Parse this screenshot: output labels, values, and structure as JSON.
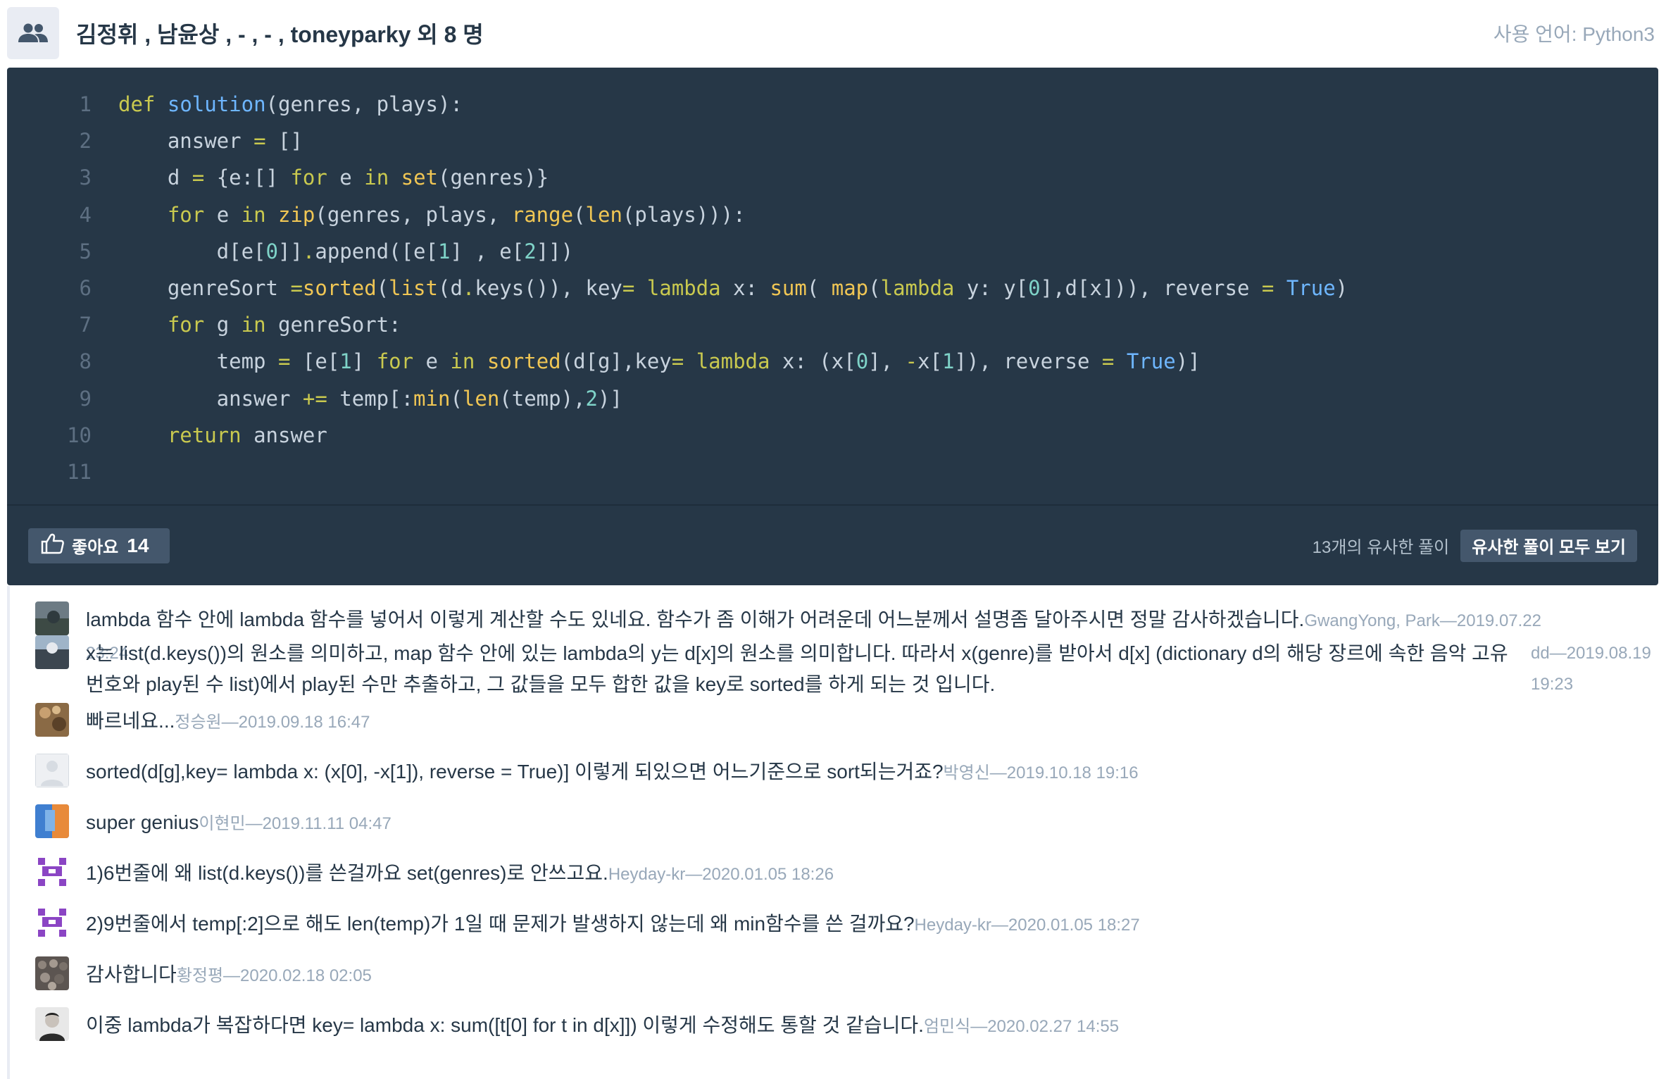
{
  "header": {
    "team_names": "김정휘 , 남윤상 , - , - , toneyparky 외 8 명",
    "language": "사용 언어: Python3"
  },
  "code": {
    "line_numbers": [
      "1",
      "2",
      "3",
      "4",
      "5",
      "6",
      "7",
      "8",
      "9",
      "10",
      "11"
    ]
  },
  "footer": {
    "like_label": "좋아요",
    "like_count": "14",
    "similar_count": "13개의 유사한 풀이",
    "similar_button": "유사한 풀이 모두 보기"
  },
  "comments": [
    {
      "text": "lambda 함수 안에 lambda 함수를 넣어서 이렇게 계산할 수도 있네요. 함수가 좀 이해가 어려운데 어느분께서 설명좀 달아주시면 정말 감사하겠습니다.",
      "meta": "GwangYong, Park—2019.07.22 23:24"
    },
    {
      "text": "x는 list(d.keys())의 원소를 의미하고, map 함수 안에 있는 lambda의 y는 d[x]의 원소를 의미합니다. 따라서 x(genre)를 받아서 d[x] (dictionary d의 해당 장르에 속한 음악 고유번호와 play된 수 list)에서 play된 수만 추출하고, 그 값들을 모두 합한 값을 key로 sorted를 하게 되는 것 입니다.",
      "meta": "dd—2019.08.19 19:23"
    },
    {
      "text": "빠르네요...",
      "meta": "정승원—2019.09.18 16:47"
    },
    {
      "text": "sorted(d[g],key= lambda x: (x[0], -x[1]), reverse = True)] 이렇게 되있으면 어느기준으로 sort되는거죠?",
      "meta": "박영신—2019.10.18 19:16"
    },
    {
      "text": "super genius",
      "meta": "이현민—2019.11.11 04:47"
    },
    {
      "text": "1)6번줄에 왜 list(d.keys())를 쓴걸까요 set(genres)로 안쓰고요.",
      "meta": "Heyday-kr—2020.01.05 18:26"
    },
    {
      "text": "2)9번줄에서 temp[:2]으로 해도 len(temp)가 1일 때 문제가 발생하지 않는데 왜 min함수를 쓴 걸까요?",
      "meta": "Heyday-kr—2020.01.05 18:27"
    },
    {
      "text": "감사합니다",
      "meta": "황정평—2020.02.18 02:05"
    },
    {
      "text": "이중 lambda가 복잡하다면 key= lambda x: sum([t[0] for t in d[x]]) 이렇게 수정해도 통할 것 같습니다.",
      "meta": "엄민식—2020.02.27 14:55"
    }
  ]
}
